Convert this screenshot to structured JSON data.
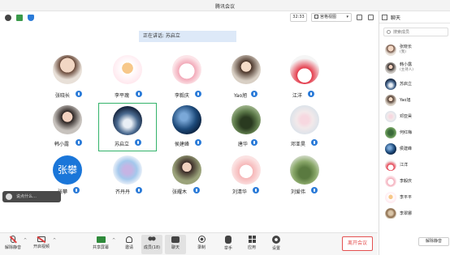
{
  "window": {
    "title": "腾讯会议"
  },
  "toolbar": {
    "time": "32:33",
    "view_label": "宫格视图",
    "icons": [
      "info-icon",
      "signal-icon",
      "shield-icon"
    ],
    "colors": {
      "shield": "#2b7bd8",
      "signal": "#3a9a4a"
    }
  },
  "meeting": {
    "speaking": "正在讲话: 苏启立",
    "chat_hint": "说点什么…"
  },
  "participants": [
    {
      "name": "张晓长"
    },
    {
      "name": "李平瑰"
    },
    {
      "name": "李毅庆"
    },
    {
      "name": "Yao旭"
    },
    {
      "name": "江洋"
    },
    {
      "name": "韩小露"
    },
    {
      "name": "苏启立"
    },
    {
      "name": "侯建峰"
    },
    {
      "name": "唐华"
    },
    {
      "name": "邓亚昊"
    },
    {
      "name": "张攀",
      "avatar_text": "张攀"
    },
    {
      "name": "齐丹丹"
    },
    {
      "name": "张耀木"
    },
    {
      "name": "刘清华"
    },
    {
      "name": "刘爱伟"
    }
  ],
  "bottombar": {
    "items": [
      {
        "label": "解除静音",
        "icon": "mic-muted-icon"
      },
      {
        "label": "开启视频",
        "icon": "camera-off-icon"
      },
      {
        "label": "共享屏幕",
        "icon": "share-screen-icon"
      },
      {
        "label": "邀请",
        "icon": "invite-icon"
      },
      {
        "label": "成员(18)",
        "icon": "members-icon"
      },
      {
        "label": "聊天",
        "icon": "chat-icon"
      },
      {
        "label": "录制",
        "icon": "record-icon"
      },
      {
        "label": "举手",
        "icon": "raise-hand-icon"
      },
      {
        "label": "应用",
        "icon": "apps-icon"
      },
      {
        "label": "设置",
        "icon": "settings-icon"
      }
    ],
    "leave_label": "离开会议"
  },
  "panel": {
    "title": "聊天",
    "search_placeholder": "搜索成员",
    "members": [
      {
        "name": "张晓长",
        "sub": "(我)"
      },
      {
        "name": "韩小露",
        "sub": "(主持人)"
      },
      {
        "name": "苏启立",
        "sub": ""
      },
      {
        "name": "Yao旭",
        "sub": ""
      },
      {
        "name": "邓亚昊",
        "sub": ""
      },
      {
        "name": "何红梅",
        "sub": ""
      },
      {
        "name": "侯建峰",
        "sub": ""
      },
      {
        "name": "江洋",
        "sub": ""
      },
      {
        "name": "李毅庆",
        "sub": ""
      },
      {
        "name": "李平平",
        "sub": ""
      },
      {
        "name": "李翠娜",
        "sub": ""
      }
    ],
    "unmute_all": "解除静音"
  }
}
